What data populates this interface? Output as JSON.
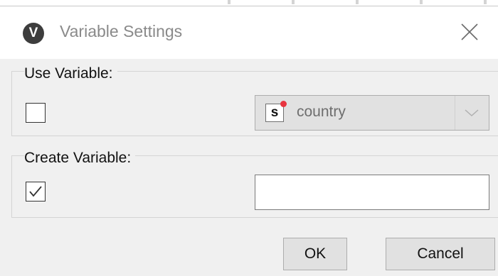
{
  "window": {
    "title": "Variable Settings",
    "logo_letter": "V",
    "close_icon": "close-icon"
  },
  "use_variable": {
    "label": "Use Variable:",
    "checked": false,
    "select": {
      "value": "country",
      "icon": "string-variable-icon",
      "icon_letter": "s",
      "icon_dot_color": "#e8343f",
      "dropdown_icon": "chevron-down-icon"
    }
  },
  "create_variable": {
    "label": "Create Variable:",
    "checked": true,
    "input_value": ""
  },
  "buttons": {
    "ok": "OK",
    "cancel": "Cancel"
  },
  "colors": {
    "dialog_bg": "#f0f0f0",
    "button_bg": "#e1e1e1",
    "title_text": "#8a8a8a"
  }
}
